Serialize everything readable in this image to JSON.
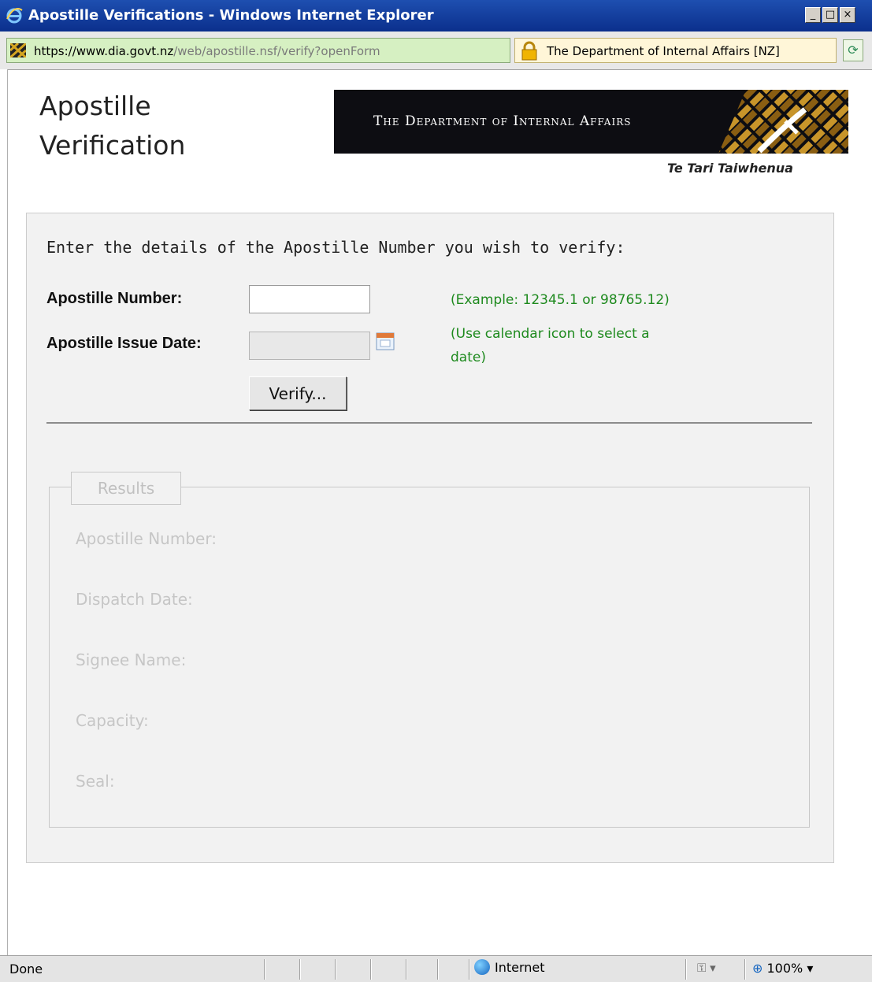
{
  "window": {
    "title": "Apostille Verifications - Windows Internet Explorer",
    "controls": {
      "minimize": "_",
      "maximize": "□",
      "close": "×"
    }
  },
  "addressbar": {
    "url_scheme": "https://",
    "url_domain": "www.dia.govt.nz",
    "url_path": "/web/apostille.nsf/verify?openForm",
    "security_label": "The Department of Internal Affairs [NZ]"
  },
  "header": {
    "page_title_line1": "Apostille",
    "page_title_line2": "Verification",
    "banner_text": "The Department of Internal Affairs",
    "banner_subtitle": "Te Tari Taiwhenua"
  },
  "form": {
    "intro": "Enter the details of the Apostille Number you wish to verify:",
    "apostille_number_label": "Apostille Number:",
    "apostille_number_value": "",
    "issue_date_label": "Apostille Issue Date:",
    "issue_date_value": "",
    "example_hint": "(Example:  12345.1 or 98765.12)",
    "calendar_hint": "(Use calendar icon to select a date)",
    "verify_button": "Verify..."
  },
  "results": {
    "legend": "Results",
    "fields": [
      "Apostille Number:",
      "Dispatch Date:",
      "Signee Name:",
      "Capacity:",
      "Seal:"
    ]
  },
  "statusbar": {
    "status": "Done",
    "zone": "Internet",
    "zoom": "100%"
  },
  "colors": {
    "titlebar": "#0b2f8c",
    "hint_green": "#1e8a1e",
    "panel_bg": "#f2f2f2"
  }
}
